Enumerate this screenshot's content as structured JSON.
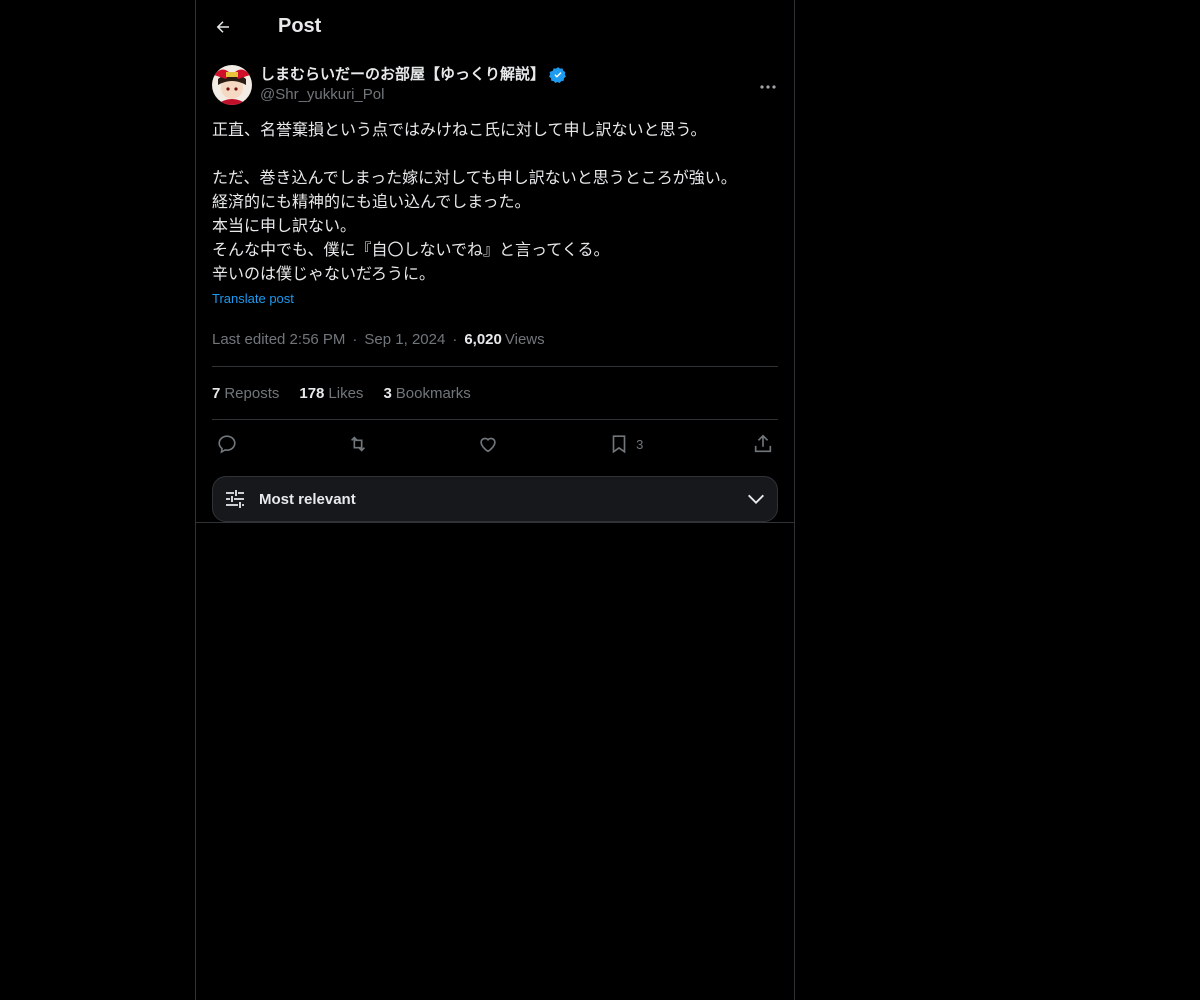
{
  "header": {
    "title": "Post"
  },
  "author": {
    "name": "しまむらいだーのお部屋【ゆっくり解説】",
    "handle": "@Shr_yukkuri_Pol"
  },
  "post": {
    "lines": [
      "正直、名誉棄損という点ではみけねこ氏に対して申し訳ないと思う。",
      "",
      "ただ、巻き込んでしまった嫁に対しても申し訳ないと思うところが強い。",
      "経済的にも精神的にも追い込んでしまった。",
      "本当に申し訳ない。",
      "そんな中でも、僕に『自〇しないでね』と言ってくる。",
      "辛いのは僕じゃないだろうに。"
    ],
    "translate_label": "Translate post",
    "edited": "Last edited 2:56 PM",
    "date": "Sep 1, 2024",
    "views_count": "6,020",
    "views_label": "Views"
  },
  "stats": {
    "reposts_count": "7",
    "reposts_label": "Reposts",
    "likes_count": "178",
    "likes_label": "Likes",
    "bookmarks_count": "3",
    "bookmarks_label": "Bookmarks"
  },
  "actions": {
    "bookmark_count": "3",
    "icons": [
      "reply-icon",
      "repost-icon",
      "like-icon",
      "bookmark-icon",
      "share-icon"
    ]
  },
  "sort": {
    "label": "Most relevant"
  },
  "colors": {
    "accent": "#1d9bf0",
    "muted": "#71767b",
    "text": "#e7e9ea",
    "border": "#2f3336"
  }
}
